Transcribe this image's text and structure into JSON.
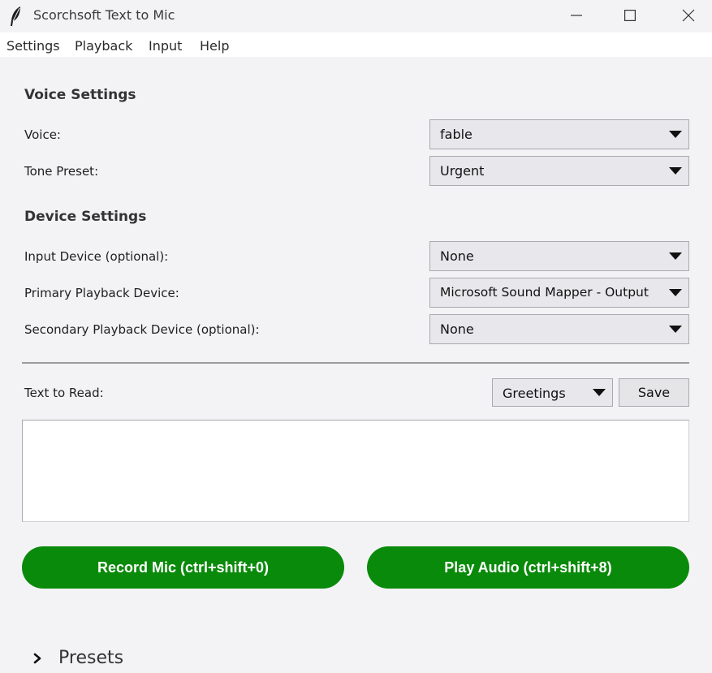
{
  "window": {
    "title": "Scorchsoft Text to Mic"
  },
  "menu": {
    "items": [
      "Settings",
      "Playback",
      "Input",
      "Help"
    ]
  },
  "voice_settings": {
    "heading": "Voice Settings",
    "voice": {
      "label": "Voice:",
      "value": "fable"
    },
    "tone_preset": {
      "label": "Tone Preset:",
      "value": "Urgent"
    }
  },
  "device_settings": {
    "heading": "Device Settings",
    "input_device": {
      "label": "Input Device (optional):",
      "value": "None"
    },
    "primary_playback": {
      "label": "Primary Playback Device:",
      "value": "Microsoft Sound Mapper - Output"
    },
    "secondary_playback": {
      "label": "Secondary Playback Device (optional):",
      "value": "None"
    }
  },
  "text_section": {
    "label": "Text to Read:",
    "category_value": "Greetings",
    "save_label": "Save",
    "text_value": ""
  },
  "actions": {
    "record_label": "Record Mic (ctrl+shift+0)",
    "play_label": "Play Audio (ctrl+shift+8)"
  },
  "presets": {
    "label": "Presets"
  },
  "colors": {
    "accent_green": "#0a8a0a",
    "background": "#f3f3f6"
  },
  "icons": {
    "app": "feather-icon",
    "minimize": "minimize-icon",
    "maximize": "maximize-icon",
    "close": "close-icon",
    "dropdown": "triangle-down-icon",
    "expand": "chevron-right-icon"
  }
}
